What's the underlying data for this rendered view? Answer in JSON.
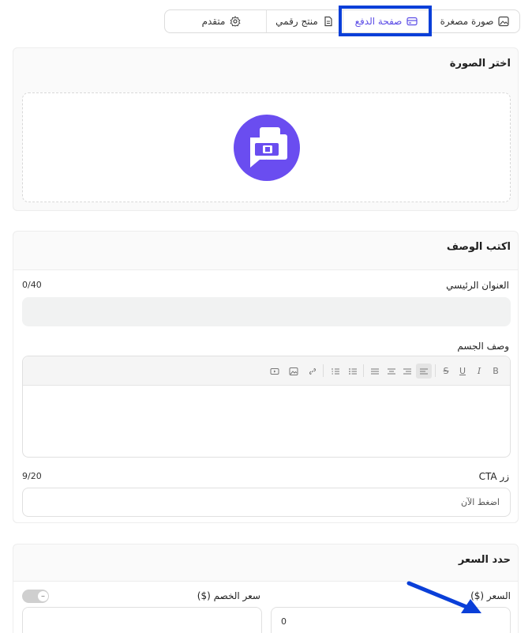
{
  "tabs": [
    {
      "label": "صورة مصغرة",
      "icon": "image-icon"
    },
    {
      "label": "صفحة الدفع",
      "icon": "credit-card-icon"
    },
    {
      "label": "منتج رقمي",
      "icon": "document-icon"
    },
    {
      "label": "متقدم",
      "icon": "gear-icon"
    }
  ],
  "image_section": {
    "title": "اختر الصورة"
  },
  "description_section": {
    "title": "اكتب الوصف",
    "main_title_label": "العنوان الرئيسي",
    "main_title_counter": "0/40",
    "main_title_value": "",
    "body_label": "وصف الجسم",
    "toolbar": [
      "B",
      "I",
      "U",
      "S",
      "align-left",
      "align-center",
      "align-right",
      "align-justify",
      "bullet-list",
      "numbered-list",
      "link",
      "image",
      "video"
    ],
    "cta_label": "زر CTA",
    "cta_counter": "9/20",
    "cta_value": "اضغط الآن"
  },
  "price_section": {
    "title": "حدد السعر",
    "price_label": "السعر ($)",
    "price_value": "0",
    "discount_label": "سعر الخصم ($)",
    "discount_toggle": "off"
  },
  "colors": {
    "accent": "#5b4ce6",
    "highlight": "#0a3fd8"
  }
}
